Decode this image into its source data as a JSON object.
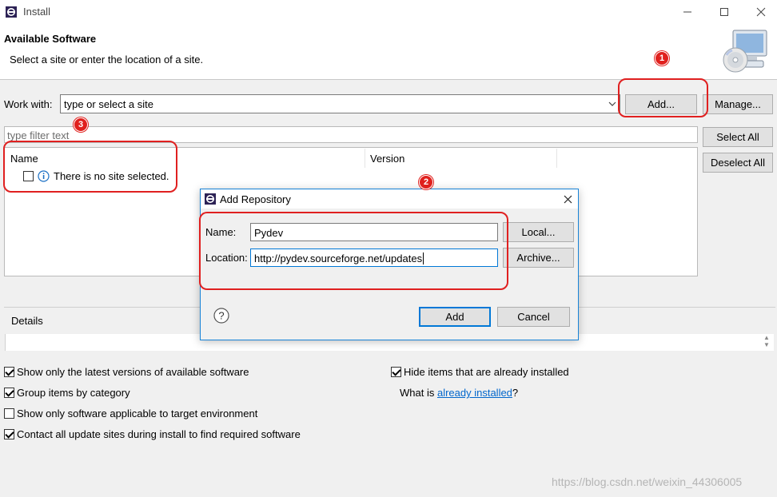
{
  "window": {
    "title": "Install",
    "icon": "eclipse-icon",
    "controls": [
      "minimize-icon",
      "maximize-icon",
      "close-icon"
    ]
  },
  "header": {
    "title": "Available Software",
    "description": "Select a site or enter the location of a site.",
    "image": "install-cd-icon"
  },
  "work_with": {
    "label": "Work with:",
    "value": "type or select a site",
    "add_label": "Add...",
    "manage_label": "Manage..."
  },
  "filter": {
    "placeholder": "type filter text"
  },
  "buttons": {
    "select_all": "Select All",
    "deselect_all": "Deselect All"
  },
  "table": {
    "columns": [
      "Name",
      "Version"
    ],
    "rows": [
      {
        "text": "There is no site selected.",
        "checked": false,
        "icon": "info-icon"
      }
    ]
  },
  "details": {
    "label": "Details"
  },
  "options": {
    "show_latest": {
      "label": "Show only the latest versions of available software",
      "checked": true
    },
    "group_items": {
      "label": "Group items by category",
      "checked": true
    },
    "show_applicable": {
      "label": "Show only software applicable to target environment",
      "checked": false
    },
    "contact_sites": {
      "label": "Contact all update sites during install to find required software",
      "checked": true
    },
    "hide_installed": {
      "label": "Hide items that are already installed",
      "checked": true
    },
    "what_is_prefix": "What is ",
    "what_is_link": "already installed",
    "what_is_suffix": "?"
  },
  "dialog": {
    "title": "Add Repository",
    "name_label": "Name:",
    "name_value": "Pydev",
    "local_label": "Local...",
    "location_label": "Location:",
    "location_value": "http://pydev.sourceforge.net/updates",
    "archive_label": "Archive...",
    "add_label": "Add",
    "cancel_label": "Cancel"
  },
  "annotations": {
    "badge_1": "1",
    "badge_2": "2",
    "badge_3": "3",
    "color": "#e02020"
  },
  "watermark": "https://blog.csdn.net/weixin_44306005"
}
